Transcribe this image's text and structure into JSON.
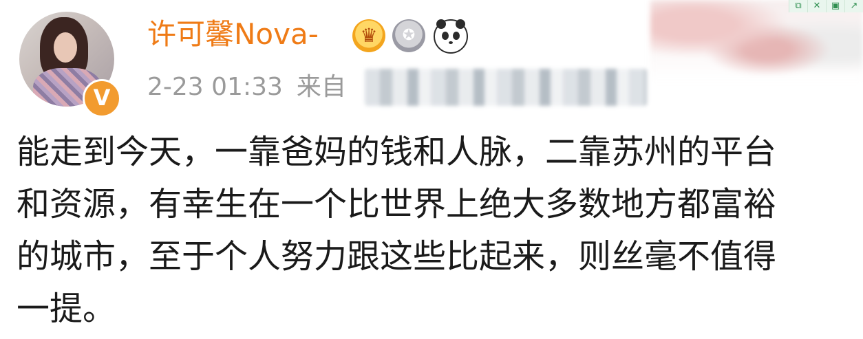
{
  "user": {
    "name": "许可馨Nova-",
    "verified_badge": "V",
    "badges": [
      "crown-badge-icon",
      "medal-badge-icon",
      "panda-badge-icon"
    ]
  },
  "meta": {
    "date": "2-23 01:33",
    "source_prefix": "来自"
  },
  "post": {
    "lines": [
      "能走到今天，一靠爸妈的钱和人脉，二靠苏州的平台",
      "和资源，有幸生在一个比世界上绝大多数地方都富裕",
      "的城市，至于个人努力跟这些比起来，则丝毫不值得",
      "一提。"
    ]
  },
  "colors": {
    "username": "#ef7b16",
    "meta": "#9a9a9a",
    "text": "#1a1a1a",
    "verified": "#f29b2f"
  },
  "toolbar": {
    "icons": [
      "copy-icon",
      "close-icon",
      "save-icon",
      "external-icon"
    ]
  }
}
